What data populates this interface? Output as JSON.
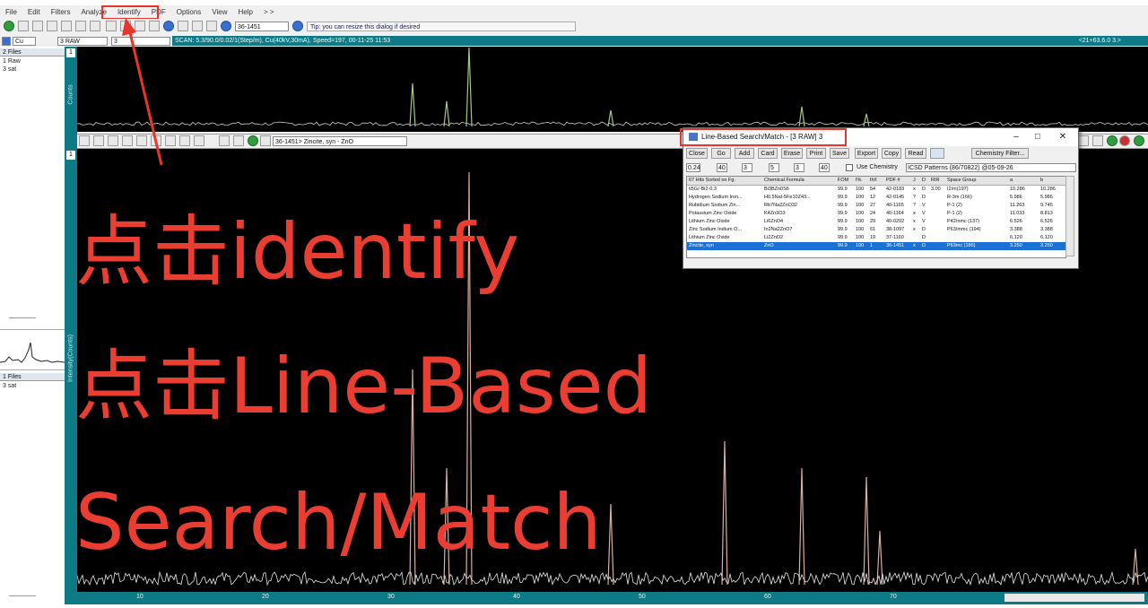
{
  "menu": [
    "File",
    "Edit",
    "Filters",
    "Analyze",
    "Identify",
    "PDF",
    "Options",
    "View",
    "Help",
    "> >"
  ],
  "toolbar": {
    "combo_value": "36-1451",
    "tip": "Tip: you can resize this dialog if desired"
  },
  "row2": {
    "combo_left": "Cu",
    "combo_mid": "3 RAW",
    "field": "3"
  },
  "scan_info": "SCAN: 5.3/90.0/0.02/1(Step/m), Cu(40kV,30mA), Speed=197, 00-11-25 11:53",
  "scan_info_right": "<21+63.6.0 3.>",
  "left_panel": {
    "files_top_header": "2 Files",
    "files_top": [
      "1 Raw",
      "3 sat"
    ],
    "files_bottom_header": "1 Files",
    "files_bottom": [
      "3 sat"
    ]
  },
  "axes": {
    "top_label": "Counts",
    "bottom_label": "Intensity(Counts)",
    "top_index": "1",
    "bottom_index": "1"
  },
  "sub_toolbar": {
    "combo_value": "36-1451> Zincite, syn - ZnO"
  },
  "x_ticks": [
    "10",
    "20",
    "30",
    "40",
    "50",
    "60",
    "70"
  ],
  "dialog": {
    "title": "Line-Based Search/Match - [3 RAW] 3",
    "buttons": [
      "Close",
      "Go",
      "Add",
      "Card",
      "Erase",
      "Print",
      "Save",
      "Export",
      "Copy",
      "Read",
      "Chemistry Filter..."
    ],
    "params": {
      "p1": "0.24",
      "p2": "40",
      "p3": "3",
      "p4": "5",
      "p5": "3",
      "p6": "40",
      "use_chemistry": "Use Chemistry",
      "database": "ICSD Patterns (86/70822) @05-09-26"
    },
    "columns": [
      "67 Hits Sorted on Fg.",
      "Chemical Formula",
      "FOM",
      "I%",
      "Ih/I",
      "PDF #",
      "J",
      "D",
      "RIR",
      "Space Group",
      "a",
      "b"
    ],
    "rows": [
      [
        "ti5G/-Bi2-0.3",
        "Bi3BZn0S6",
        "99.9",
        "100",
        "54",
        "42-0183",
        "x",
        "D",
        "3.00",
        "I2/m(197)",
        "10.286",
        "10.286"
      ],
      [
        "Hydrogen Sodium Iron...",
        "H0.5NaI-5Fe10Z43...",
        "99.9",
        "100",
        "12",
        "42-0145",
        "?",
        "D",
        "",
        "R-3m (166)",
        "5.986",
        "5.986"
      ],
      [
        "Rubidium Sodium Zin...",
        "Rb7Na2ZnO32",
        "99.9",
        "100",
        "27",
        "40-1165",
        "?",
        "V",
        "",
        "P-1 (2)",
        "11.263",
        "9.745"
      ],
      [
        "Potassium Zinc Oxide",
        "K4Zn3O3",
        "99.9",
        "100",
        "24",
        "40-1164",
        "x",
        "V",
        "",
        "P-1 (2)",
        "11.033",
        "8.813"
      ],
      [
        "Lithium Zinc Oxide",
        "Li6ZnO4",
        "99.9",
        "100",
        "29",
        "40-0202",
        "x",
        "V",
        "",
        "P42/nmc (137)",
        "6.526",
        "6.526"
      ],
      [
        "Zinc Sodium Indium O...",
        "In2Na2ZnO7",
        "99.9",
        "100",
        "61",
        "38-1097",
        "x",
        "D",
        "",
        "P63/mmc (194)",
        "3.388",
        "3.388"
      ],
      [
        "Lithium Zinc Oxide",
        "Li2ZnO2",
        "99.9",
        "100",
        "19",
        "37-1160",
        "",
        "D",
        "",
        "",
        "6.120",
        "6.120"
      ],
      [
        "Zincite, syn",
        "ZnO",
        "99.9",
        "100",
        "1",
        "36-1451",
        "x",
        "D",
        "",
        "P63mc (186)",
        "3.250",
        "3.250"
      ]
    ]
  },
  "captions": [
    "点击identify",
    "点击Line-Based",
    "Search/Match"
  ],
  "colors": {
    "highlight": "#e8342a",
    "teal": "#0d7a86",
    "trace": "#ffffff",
    "peak": "#a3c785"
  }
}
